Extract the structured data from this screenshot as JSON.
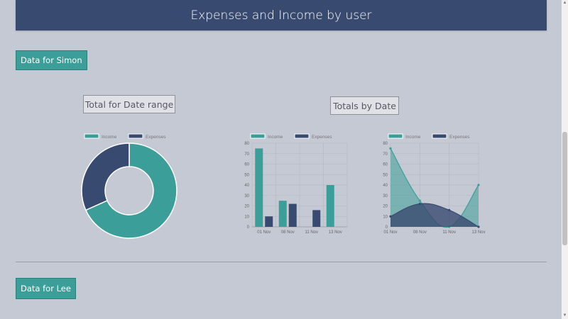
{
  "header": {
    "title": "Expenses and Income by user"
  },
  "users": [
    {
      "button_label": "Data for Simon"
    },
    {
      "button_label": "Data for Lee"
    }
  ],
  "sections": {
    "total_title": "Total for Date range",
    "by_date_title": "Totals by Date"
  },
  "colors": {
    "income": "#3c9e98",
    "expenses": "#384a6f",
    "header": "#384a6f",
    "background": "#c5c9d4"
  },
  "chart_data": [
    {
      "type": "pie",
      "variant": "doughnut",
      "labels": [
        "Income",
        "Expenses"
      ],
      "values": [
        140,
        65
      ],
      "legend": "top"
    },
    {
      "type": "bar",
      "categories": [
        "01 Nov",
        "08 Nov",
        "11 Nov",
        "13 Nov"
      ],
      "series": [
        {
          "name": "Income",
          "values": [
            75,
            25,
            0,
            40
          ]
        },
        {
          "name": "Expenses",
          "values": [
            10,
            22,
            16,
            0
          ]
        }
      ],
      "ylim": [
        0,
        80
      ],
      "yticks": [
        "0",
        "10",
        "20",
        "30",
        "40",
        "50",
        "60",
        "70",
        "80"
      ],
      "legend": "top",
      "grid": true
    },
    {
      "type": "area",
      "categories": [
        "01 Nov",
        "08 Nov",
        "11 Nov",
        "13 Nov"
      ],
      "series": [
        {
          "name": "Income",
          "values": [
            75,
            25,
            0,
            40
          ]
        },
        {
          "name": "Expenses",
          "values": [
            10,
            22,
            16,
            0
          ]
        }
      ],
      "ylim": [
        0,
        80
      ],
      "yticks": [
        "0",
        "10",
        "20",
        "30",
        "40",
        "50",
        "60",
        "70",
        "80"
      ],
      "legend": "top",
      "grid": true
    }
  ]
}
